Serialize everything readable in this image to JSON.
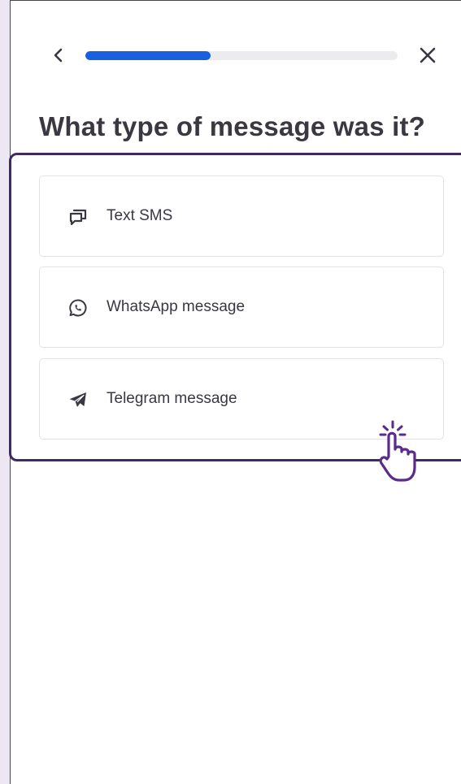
{
  "header": {
    "back_icon": "chevron-left-icon",
    "close_icon": "close-icon",
    "progress": 0.4,
    "progress_color": "#1a5fe0"
  },
  "question": {
    "title": "What type of message was it?"
  },
  "options": [
    {
      "label": "Text SMS",
      "icon": "chat-bubbles-icon"
    },
    {
      "label": "WhatsApp message",
      "icon": "whatsapp-icon"
    },
    {
      "label": "Telegram message",
      "icon": "telegram-icon"
    }
  ],
  "overlay": {
    "highlight_color": "#3f2a63",
    "cursor_icon": "pointing-hand-icon"
  }
}
